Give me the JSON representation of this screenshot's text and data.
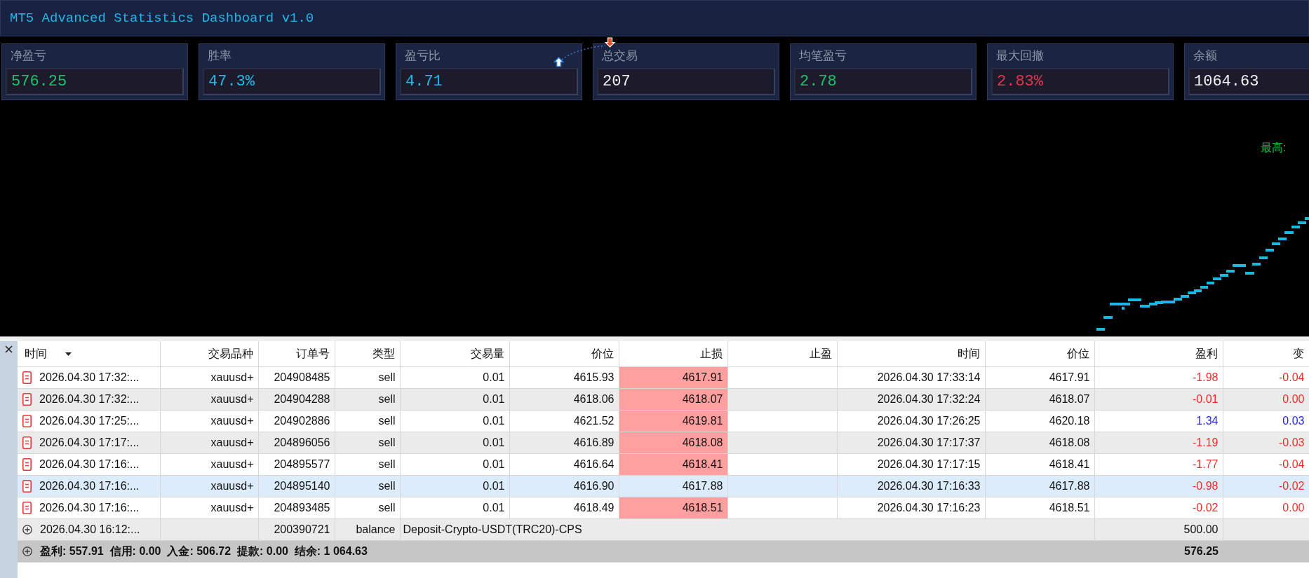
{
  "window": {
    "title": "MT5 Advanced Statistics Dashboard v1.0"
  },
  "stat_cards": [
    {
      "label": "净盈亏",
      "value": "576.25",
      "color": "#1dc46c"
    },
    {
      "label": "胜率",
      "value": "47.3%",
      "color": "#1fbcec"
    },
    {
      "label": "盈亏比",
      "value": "4.71",
      "color": "#1fbcec"
    },
    {
      "label": "总交易",
      "value": "207",
      "color": "#f2f2f2"
    },
    {
      "label": "均笔盈亏",
      "value": "2.78",
      "color": "#1dc46c"
    },
    {
      "label": "最大回撤",
      "value": "2.83%",
      "color": "#e8364f"
    },
    {
      "label": "余额",
      "value": "1064.63",
      "color": "#f2f2f2"
    }
  ],
  "chart": {
    "high_label": "最高:"
  },
  "history_table": {
    "columns": [
      {
        "label": "时间",
        "sorted": true
      },
      {
        "label": "交易品种",
        "sorted": false
      },
      {
        "label": "订单号",
        "sorted": false
      },
      {
        "label": "类型",
        "sorted": false
      },
      {
        "label": "交易量",
        "sorted": false
      },
      {
        "label": "价位",
        "sorted": false
      },
      {
        "label": "止损",
        "sorted": false
      },
      {
        "label": "止盈",
        "sorted": false
      },
      {
        "label": "时间",
        "sorted": false
      },
      {
        "label": "价位",
        "sorted": false
      },
      {
        "label": "盈利",
        "sorted": false
      },
      {
        "label": "变",
        "sorted": false
      }
    ],
    "rows": [
      {
        "kind": "trade",
        "selected": false,
        "time": "2026.04.30 17:32:...",
        "symbol": "xauusd+",
        "order": "204908485",
        "type": "sell",
        "volume": "0.01",
        "price": "4615.93",
        "sl": "4617.91",
        "sl_hit": true,
        "close_time": "2026.04.30 17:33:14",
        "close_price": "4617.91",
        "profit": "-1.98",
        "loss": true,
        "column_12": "-0.04"
      },
      {
        "kind": "trade",
        "selected": false,
        "time": "2026.04.30 17:32:...",
        "symbol": "xauusd+",
        "order": "204904288",
        "type": "sell",
        "volume": "0.01",
        "price": "4618.06",
        "sl": "4618.07",
        "sl_hit": true,
        "close_time": "2026.04.30 17:32:24",
        "close_price": "4618.07",
        "profit": "-0.01",
        "loss": true,
        "column_12": "0.00"
      },
      {
        "kind": "trade",
        "selected": false,
        "time": "2026.04.30 17:25:...",
        "symbol": "xauusd+",
        "order": "204902886",
        "type": "sell",
        "volume": "0.01",
        "price": "4621.52",
        "sl": "4619.81",
        "sl_hit": true,
        "close_time": "2026.04.30 17:26:25",
        "close_price": "4620.18",
        "profit": "1.34",
        "loss": false,
        "column_12": "0.03"
      },
      {
        "kind": "trade",
        "selected": false,
        "time": "2026.04.30 17:17:...",
        "symbol": "xauusd+",
        "order": "204896056",
        "type": "sell",
        "volume": "0.01",
        "price": "4616.89",
        "sl": "4618.08",
        "sl_hit": true,
        "close_time": "2026.04.30 17:17:37",
        "close_price": "4618.08",
        "profit": "-1.19",
        "loss": true,
        "column_12": "-0.03"
      },
      {
        "kind": "trade",
        "selected": false,
        "time": "2026.04.30 17:16:...",
        "symbol": "xauusd+",
        "order": "204895577",
        "type": "sell",
        "volume": "0.01",
        "price": "4616.64",
        "sl": "4618.41",
        "sl_hit": true,
        "close_time": "2026.04.30 17:17:15",
        "close_price": "4618.41",
        "profit": "-1.77",
        "loss": true,
        "column_12": "-0.04"
      },
      {
        "kind": "trade",
        "selected": true,
        "time": "2026.04.30 17:16:...",
        "symbol": "xauusd+",
        "order": "204895140",
        "type": "sell",
        "volume": "0.01",
        "price": "4616.90",
        "sl": "4617.88",
        "sl_hit": false,
        "close_time": "2026.04.30 17:16:33",
        "close_price": "4617.88",
        "profit": "-0.98",
        "loss": true,
        "column_12": "-0.02"
      },
      {
        "kind": "trade",
        "selected": false,
        "time": "2026.04.30 17:16:...",
        "symbol": "xauusd+",
        "order": "204893485",
        "type": "sell",
        "volume": "0.01",
        "price": "4618.49",
        "sl": "4618.51",
        "sl_hit": true,
        "close_time": "2026.04.30 17:16:23",
        "close_price": "4618.51",
        "profit": "-0.02",
        "loss": true,
        "column_12": "0.00"
      },
      {
        "kind": "balance",
        "selected": false,
        "time": "2026.04.30 16:12:...",
        "order": "200390721",
        "type": "balance",
        "comment": "Deposit-Crypto-USDT(TRC20)-CPS",
        "profit": "500.00"
      }
    ],
    "summary": {
      "text": "盈利: 557.91  信用: 0.00  入金: 506.72  提款: 0.00  结余: 1 064.63",
      "profit": "576.25"
    }
  }
}
